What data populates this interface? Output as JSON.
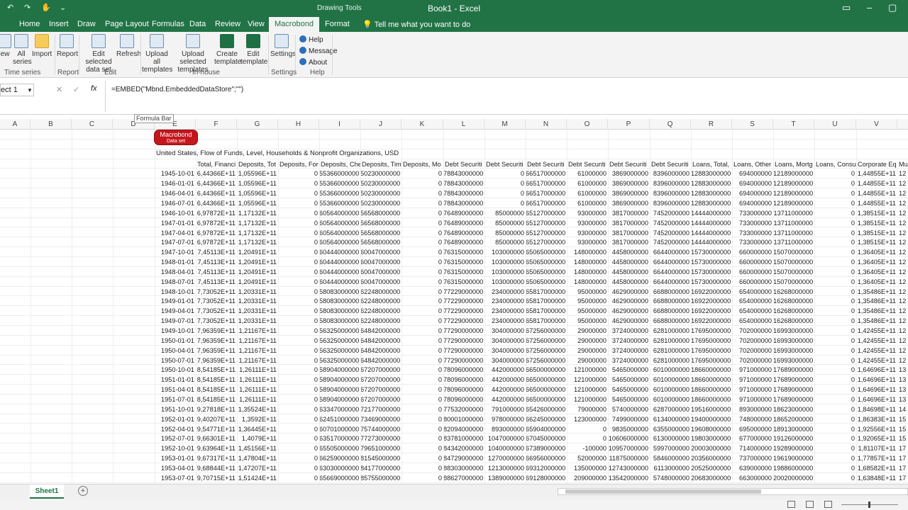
{
  "window": {
    "title": "Book1 - Excel",
    "context_label": "Drawing Tools"
  },
  "tabs": [
    "Home",
    "Insert",
    "Draw",
    "Page Layout",
    "Formulas",
    "Data",
    "Review",
    "View",
    "Macrobond",
    "Format"
  ],
  "active_tab": "Macrobond",
  "tell_me": "Tell me what you want to do",
  "ribbon": {
    "buttons": [
      {
        "label": "iew",
        "icon": "view-icon"
      },
      {
        "label": "All series",
        "icon": "all-series-icon"
      },
      {
        "label": "Import",
        "icon": "folder-icon"
      },
      {
        "label": "Report",
        "icon": "report-icon"
      },
      {
        "label": "Edit selected data set",
        "icon": "edit-dataset-icon"
      },
      {
        "label": "Refresh",
        "icon": "refresh-icon"
      },
      {
        "label": "Upload all templates",
        "icon": "upload-all-icon"
      },
      {
        "label": "Upload selected templates",
        "icon": "upload-selected-icon"
      },
      {
        "label": "Create template",
        "icon": "excel-template-icon"
      },
      {
        "label": "Edit template",
        "icon": "excel-template-icon"
      },
      {
        "label": "Settings",
        "icon": "settings-icon"
      }
    ],
    "small_buttons": [
      "Help",
      "Message",
      "About"
    ],
    "groups": [
      "Time series",
      "Report",
      "Edit",
      "In-house",
      "Settings",
      "Help"
    ]
  },
  "namebox": "ect 1",
  "formula": "=EMBED(\"Mbnd.EmbeddedDataStore\";\"\")",
  "tooltip": "Formula Bar",
  "columns": [
    "A",
    "B",
    "C",
    "D",
    "E",
    "F",
    "G",
    "H",
    "I",
    "J",
    "K",
    "L",
    "M",
    "N",
    "O",
    "P",
    "Q",
    "R",
    "S",
    "T",
    "U",
    "V"
  ],
  "badge": {
    "title": "Macrobond",
    "sub": "Data set"
  },
  "series_title": "United States, Flow of Funds, Level, Households & Nonprofit Organizations, USD",
  "headers": [
    "Total, Financi",
    "Deposits, Tot",
    "Deposits, For",
    "Deposits, Che",
    "Deposits, Tim",
    "Deposits, Mo",
    "Debt Securiti",
    "Debt Securiti",
    "Debt Securiti",
    "Debt Securiti",
    "Debt Securiti",
    "Debt Securiti",
    "Loans, Total,",
    "Loans, Other",
    "Loans, Mortg",
    "Loans, Consu",
    "Corporate Eq",
    "Mu"
  ],
  "rows": [
    [
      "1945-10-01",
      "6,44366E+11",
      "1,05596E+11",
      "0",
      "55366000000",
      "50230000000",
      "0",
      "78843000000",
      "0",
      "66517000000",
      "61000000",
      "3869000000",
      "8396000000",
      "12883000000",
      "694000000",
      "12189000000",
      "0",
      "1,44855E+11",
      "12"
    ],
    [
      "1946-01-01",
      "6,44366E+11",
      "1,05596E+11",
      "0",
      "55366000000",
      "50230000000",
      "0",
      "78843000000",
      "0",
      "66517000000",
      "61000000",
      "3869000000",
      "8396000000",
      "12883000000",
      "694000000",
      "12189000000",
      "0",
      "1,44855E+11",
      "12"
    ],
    [
      "1946-04-01",
      "6,44366E+11",
      "1,05596E+11",
      "0",
      "55366000000",
      "50230000000",
      "0",
      "78843000000",
      "0",
      "66517000000",
      "61000000",
      "3869000000",
      "8396000000",
      "12883000000",
      "694000000",
      "12189000000",
      "0",
      "1,44855E+11",
      "12"
    ],
    [
      "1946-07-01",
      "6,44366E+11",
      "1,05596E+11",
      "0",
      "55366000000",
      "50230000000",
      "0",
      "78843000000",
      "0",
      "66517000000",
      "61000000",
      "3869000000",
      "8396000000",
      "12883000000",
      "694000000",
      "12189000000",
      "0",
      "1,44855E+11",
      "12"
    ],
    [
      "1946-10-01",
      "6,97872E+11",
      "1,17132E+11",
      "0",
      "60564000000",
      "56568000000",
      "0",
      "76489000000",
      "85000000",
      "65127000000",
      "93000000",
      "3817000000",
      "7452000000",
      "14444000000",
      "733000000",
      "13711000000",
      "0",
      "1,38515E+11",
      "12"
    ],
    [
      "1947-01-01",
      "6,97872E+11",
      "1,17132E+11",
      "0",
      "60564000000",
      "56568000000",
      "0",
      "76489000000",
      "85000000",
      "65127000000",
      "93000000",
      "3817000000",
      "7452000000",
      "14444000000",
      "733000000",
      "13711000000",
      "0",
      "1,38515E+11",
      "12"
    ],
    [
      "1947-04-01",
      "6,97872E+11",
      "1,17132E+11",
      "0",
      "60564000000",
      "56568000000",
      "0",
      "76489000000",
      "85000000",
      "65127000000",
      "93000000",
      "3817000000",
      "7452000000",
      "14444000000",
      "733000000",
      "13711000000",
      "0",
      "1,38515E+11",
      "12"
    ],
    [
      "1947-07-01",
      "6,97872E+11",
      "1,17132E+11",
      "0",
      "60564000000",
      "56568000000",
      "0",
      "76489000000",
      "85000000",
      "65127000000",
      "93000000",
      "3817000000",
      "7452000000",
      "14444000000",
      "733000000",
      "13711000000",
      "0",
      "1,38515E+11",
      "12"
    ],
    [
      "1947-10-01",
      "7,45113E+11",
      "1,20491E+11",
      "0",
      "60444000000",
      "60047000000",
      "0",
      "76315000000",
      "103000000",
      "65065000000",
      "148000000",
      "4458000000",
      "6644000000",
      "15730000000",
      "660000000",
      "15070000000",
      "0",
      "1,36405E+11",
      "12"
    ],
    [
      "1948-01-01",
      "7,45113E+11",
      "1,20491E+11",
      "0",
      "60444000000",
      "60047000000",
      "0",
      "76315000000",
      "103000000",
      "65065000000",
      "148000000",
      "4458000000",
      "6644000000",
      "15730000000",
      "660000000",
      "15070000000",
      "0",
      "1,36405E+11",
      "12"
    ],
    [
      "1948-04-01",
      "7,45113E+11",
      "1,20491E+11",
      "0",
      "60444000000",
      "60047000000",
      "0",
      "76315000000",
      "103000000",
      "65065000000",
      "148000000",
      "4458000000",
      "6644000000",
      "15730000000",
      "660000000",
      "15070000000",
      "0",
      "1,36405E+11",
      "12"
    ],
    [
      "1948-07-01",
      "7,45113E+11",
      "1,20491E+11",
      "0",
      "60444000000",
      "60047000000",
      "0",
      "76315000000",
      "103000000",
      "65065000000",
      "148000000",
      "4458000000",
      "6644000000",
      "15730000000",
      "660000000",
      "15070000000",
      "0",
      "1,36405E+11",
      "12"
    ],
    [
      "1948-10-01",
      "7,73052E+11",
      "1,20331E+11",
      "0",
      "58083000000",
      "62248000000",
      "0",
      "77229000000",
      "234000000",
      "65817000000",
      "95000000",
      "4629000000",
      "6688000000",
      "16922000000",
      "654000000",
      "16268000000",
      "0",
      "1,35486E+11",
      "12"
    ],
    [
      "1949-01-01",
      "7,73052E+11",
      "1,20331E+11",
      "0",
      "58083000000",
      "62248000000",
      "0",
      "77229000000",
      "234000000",
      "65817000000",
      "95000000",
      "4629000000",
      "6688000000",
      "16922000000",
      "654000000",
      "16268000000",
      "0",
      "1,35486E+11",
      "12"
    ],
    [
      "1949-04-01",
      "7,73052E+11",
      "1,20331E+11",
      "0",
      "58083000000",
      "62248000000",
      "0",
      "77229000000",
      "234000000",
      "65817000000",
      "95000000",
      "4629000000",
      "6688000000",
      "16922000000",
      "654000000",
      "16268000000",
      "0",
      "1,35486E+11",
      "12"
    ],
    [
      "1949-07-01",
      "7,73052E+11",
      "1,20331E+11",
      "0",
      "58083000000",
      "62248000000",
      "0",
      "77229000000",
      "234000000",
      "65817000000",
      "95000000",
      "4629000000",
      "6688000000",
      "16922000000",
      "654000000",
      "16268000000",
      "0",
      "1,35486E+11",
      "12"
    ],
    [
      "1949-10-01",
      "7,96359E+11",
      "1,21167E+11",
      "0",
      "56325000000",
      "64842000000",
      "0",
      "77290000000",
      "304000000",
      "67256000000",
      "29000000",
      "3724000000",
      "6281000000",
      "17695000000",
      "702000000",
      "16993000000",
      "0",
      "1,42455E+11",
      "12"
    ],
    [
      "1950-01-01",
      "7,96359E+11",
      "1,21167E+11",
      "0",
      "56325000000",
      "64842000000",
      "0",
      "77290000000",
      "304000000",
      "67256000000",
      "29000000",
      "3724000000",
      "6281000000",
      "17695000000",
      "702000000",
      "16993000000",
      "0",
      "1,42455E+11",
      "12"
    ],
    [
      "1950-04-01",
      "7,96359E+11",
      "1,21167E+11",
      "0",
      "56325000000",
      "64842000000",
      "0",
      "77290000000",
      "304000000",
      "67256000000",
      "29000000",
      "3724000000",
      "6281000000",
      "17695000000",
      "702000000",
      "16993000000",
      "0",
      "1,42455E+11",
      "12"
    ],
    [
      "1950-07-01",
      "7,96359E+11",
      "1,21167E+11",
      "0",
      "56325000000",
      "64842000000",
      "0",
      "77290000000",
      "304000000",
      "67256000000",
      "29000000",
      "3724000000",
      "6281000000",
      "17695000000",
      "702000000",
      "16993000000",
      "0",
      "1,42455E+11",
      "12"
    ],
    [
      "1950-10-01",
      "8,54185E+11",
      "1,26111E+11",
      "0",
      "58904000000",
      "67207000000",
      "0",
      "78096000000",
      "442000000",
      "66500000000",
      "121000000",
      "5465000000",
      "6010000000",
      "18660000000",
      "971000000",
      "17689000000",
      "0",
      "1,64696E+11",
      "13"
    ],
    [
      "1951-01-01",
      "8,54185E+11",
      "1,26111E+11",
      "0",
      "58904000000",
      "67207000000",
      "0",
      "78096000000",
      "442000000",
      "66500000000",
      "121000000",
      "5465000000",
      "6010000000",
      "18660000000",
      "971000000",
      "17689000000",
      "0",
      "1,64696E+11",
      "13"
    ],
    [
      "1951-04-01",
      "8,54185E+11",
      "1,26111E+11",
      "0",
      "58904000000",
      "67207000000",
      "0",
      "78096000000",
      "442000000",
      "66500000000",
      "121000000",
      "5465000000",
      "6010000000",
      "18660000000",
      "971000000",
      "17689000000",
      "0",
      "1,64696E+11",
      "13"
    ],
    [
      "1951-07-01",
      "8,54185E+11",
      "1,26111E+11",
      "0",
      "58904000000",
      "67207000000",
      "0",
      "78096000000",
      "442000000",
      "66500000000",
      "121000000",
      "5465000000",
      "6010000000",
      "18660000000",
      "971000000",
      "17689000000",
      "0",
      "1,64696E+11",
      "13"
    ],
    [
      "1951-10-01",
      "9,27818E+11",
      "1,35524E+11",
      "0",
      "63347000000",
      "72177000000",
      "0",
      "77532000000",
      "791000000",
      "65426000000",
      "79000000",
      "5740000000",
      "6287000000",
      "19516000000",
      "893000000",
      "18623000000",
      "0",
      "1,84698E+11",
      "14"
    ],
    [
      "1952-01-01",
      "9,40207E+11",
      "1,3592E+11",
      "0",
      "62451000000",
      "73469000000",
      "0",
      "80001000000",
      "978000000",
      "66245000000",
      "123000000",
      "7499000000",
      "6134000000",
      "19400000000",
      "748000000",
      "18652000000",
      "0",
      "1,86383E+11",
      "15"
    ],
    [
      "1952-04-01",
      "9,54771E+11",
      "1,36445E+11",
      "0",
      "60701000000",
      "75744000000",
      "0",
      "82094000000",
      "893000000",
      "65904000000",
      "0",
      "9835000000",
      "6355000000",
      "19608000000",
      "695000000",
      "18913000000",
      "0",
      "1,92556E+11",
      "15"
    ],
    [
      "1952-07-01",
      "9,66301E+11",
      "1,4079E+11",
      "0",
      "63517000000",
      "77273000000",
      "0",
      "83781000000",
      "1047000000",
      "67045000000",
      "0",
      "10606000000",
      "6130000000",
      "19803000000",
      "677000000",
      "19126000000",
      "0",
      "1,92065E+11",
      "15"
    ],
    [
      "1952-10-01",
      "9,63964E+11",
      "1,45156E+11",
      "0",
      "65505000000",
      "79651000000",
      "0",
      "84342000000",
      "1040000000",
      "67389000000",
      "-100000",
      "10957000000",
      "5997000000",
      "20003000000",
      "714000000",
      "19289000000",
      "0",
      "1,81107E+11",
      "17"
    ],
    [
      "1953-01-01",
      "9,67317E+11",
      "1,47804E+11",
      "0",
      "66259000000",
      "81545000000",
      "0",
      "84729000000",
      "1270000000",
      "66956000000",
      "52000000",
      "11875000000",
      "5846000000",
      "20356000000",
      "737000000",
      "19619000000",
      "0",
      "1,77857E+11",
      "17"
    ],
    [
      "1953-04-01",
      "9,68844E+11",
      "1,47207E+11",
      "0",
      "63030000000",
      "84177000000",
      "0",
      "88303000000",
      "1213000000",
      "69312000000",
      "135000000",
      "12743000000",
      "6113000000",
      "20525000000",
      "639000000",
      "19886000000",
      "0",
      "1,68582E+11",
      "17"
    ],
    [
      "1953-07-01",
      "9,70715E+11",
      "1,51424E+11",
      "0",
      "65669000000",
      "85755000000",
      "0",
      "88627000000",
      "1389000000",
      "69128000000",
      "209000000",
      "13542000000",
      "5748000000",
      "20683000000",
      "663000000",
      "20020000000",
      "0",
      "1,63848E+11",
      "17"
    ]
  ],
  "sheet_tab": "Sheet1",
  "add_sheet": "+"
}
